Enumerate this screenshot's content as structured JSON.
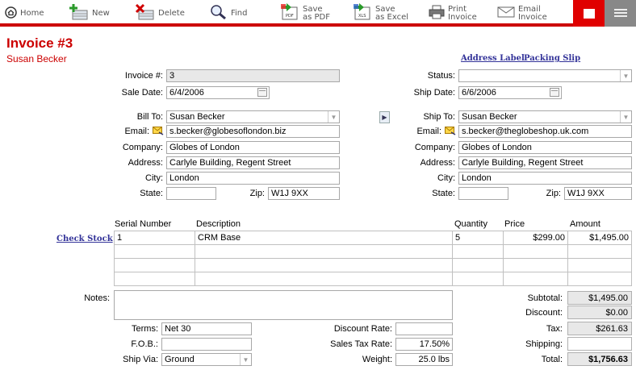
{
  "toolbar": {
    "home": "Home",
    "new": "New",
    "delete": "Delete",
    "find": "Find",
    "save_pdf_1": "Save",
    "save_pdf_2": "as PDF",
    "save_pdf_badge": "PDF",
    "save_excel_1": "Save",
    "save_excel_2": "as Excel",
    "save_excel_badge": "XLS",
    "print_1": "Print",
    "print_2": "Invoice",
    "email_1": "Email",
    "email_2": "Invoice",
    "accent_color": "#cc0000"
  },
  "header": {
    "title": "Invoice #3",
    "customer": "Susan Becker",
    "address_label_link": "Address Label",
    "packing_slip_link": "Packing Slip"
  },
  "invoice": {
    "invoice_no_label": "Invoice #:",
    "invoice_no": "3",
    "sale_date_label": "Sale Date:",
    "sale_date": "6/4/2006",
    "status_label": "Status:",
    "status": "",
    "ship_date_label": "Ship Date:",
    "ship_date": "6/6/2006"
  },
  "bill_to": {
    "label": "Bill To:",
    "name": "Susan Becker",
    "email_label": "Email:",
    "email": "s.becker@globesoflondon.biz",
    "company_label": "Company:",
    "company": "Globes of London",
    "address_label": "Address:",
    "address": "Carlyle Building, Regent Street",
    "city_label": "City:",
    "city": "London",
    "state_label": "State:",
    "state": "",
    "zip_label": "Zip:",
    "zip": "W1J 9XX"
  },
  "ship_to": {
    "label": "Ship To:",
    "name": "Susan Becker",
    "email_label": "Email:",
    "email": "s.becker@theglobeshop.uk.com",
    "company_label": "Company:",
    "company": "Globes of London",
    "address_label": "Address:",
    "address": "Carlyle Building, Regent Street",
    "city_label": "City:",
    "city": "London",
    "state_label": "State:",
    "state": "",
    "zip_label": "Zip:",
    "zip": "W1J 9XX"
  },
  "items": {
    "check_stock_link": "Check Stock",
    "headers": {
      "serial": "Serial Number",
      "description": "Description",
      "quantity": "Quantity",
      "price": "Price",
      "amount": "Amount"
    },
    "rows": [
      {
        "serial": "1",
        "description": "CRM Base",
        "quantity": "5",
        "price": "$299.00",
        "amount": "$1,495.00"
      },
      {
        "serial": "",
        "description": "",
        "quantity": "",
        "price": "",
        "amount": ""
      },
      {
        "serial": "",
        "description": "",
        "quantity": "",
        "price": "",
        "amount": ""
      },
      {
        "serial": "",
        "description": "",
        "quantity": "",
        "price": "",
        "amount": ""
      }
    ]
  },
  "footer": {
    "notes_label": "Notes:",
    "notes": "",
    "terms_label": "Terms:",
    "terms": "Net 30",
    "fob_label": "F.O.B.:",
    "fob": "",
    "ship_via_label": "Ship Via:",
    "ship_via": "Ground",
    "discount_rate_label": "Discount Rate:",
    "discount_rate": "",
    "sales_tax_rate_label": "Sales Tax Rate:",
    "sales_tax_rate": "17.50%",
    "weight_label": "Weight:",
    "weight": "25.0 lbs"
  },
  "totals": {
    "subtotal_label": "Subtotal:",
    "subtotal": "$1,495.00",
    "discount_label": "Discount:",
    "discount": "$0.00",
    "tax_label": "Tax:",
    "tax": "$261.63",
    "shipping_label": "Shipping:",
    "shipping": "",
    "total_label": "Total:",
    "total": "$1,756.63"
  }
}
